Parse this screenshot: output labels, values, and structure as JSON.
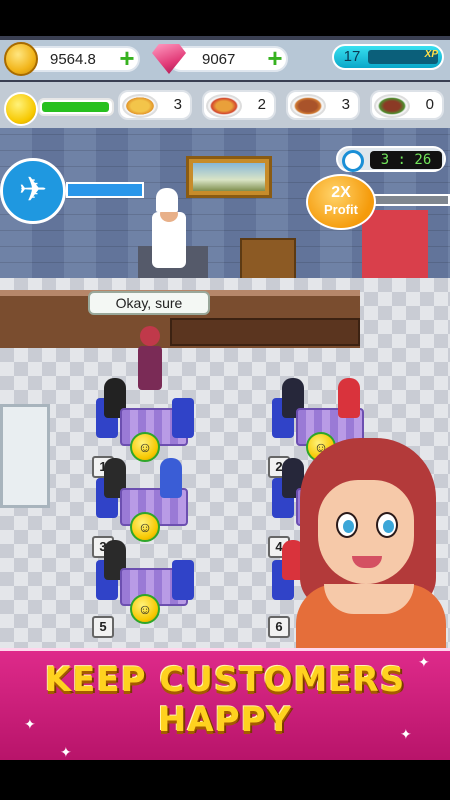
{
  "hud": {
    "coins": "9564.8",
    "gems": "9067",
    "level": "17",
    "xp_label": "XP",
    "happiness_fraction": 0.98
  },
  "dishes": [
    {
      "name": "spaghetti-icon",
      "count": "3"
    },
    {
      "name": "pizza-icon",
      "count": "2"
    },
    {
      "name": "roast-chicken-icon",
      "count": "3"
    },
    {
      "name": "steak-icon",
      "count": "0"
    }
  ],
  "timer": "3 : 26",
  "profit": {
    "line1": "2X",
    "line2": "Profit"
  },
  "speech": "Okay, sure",
  "tables": [
    {
      "number": "1"
    },
    {
      "number": "2"
    },
    {
      "number": "3"
    },
    {
      "number": "4"
    },
    {
      "number": "5"
    },
    {
      "number": "6"
    }
  ],
  "banner": {
    "line1": "KEEP CUSTOMERS",
    "line2": "HAPPY"
  },
  "colors": {
    "banner": "#d41f80",
    "banner_text": "#ffd21f",
    "xp": "#1fc3dc",
    "happy_bar": "#27c01f"
  }
}
